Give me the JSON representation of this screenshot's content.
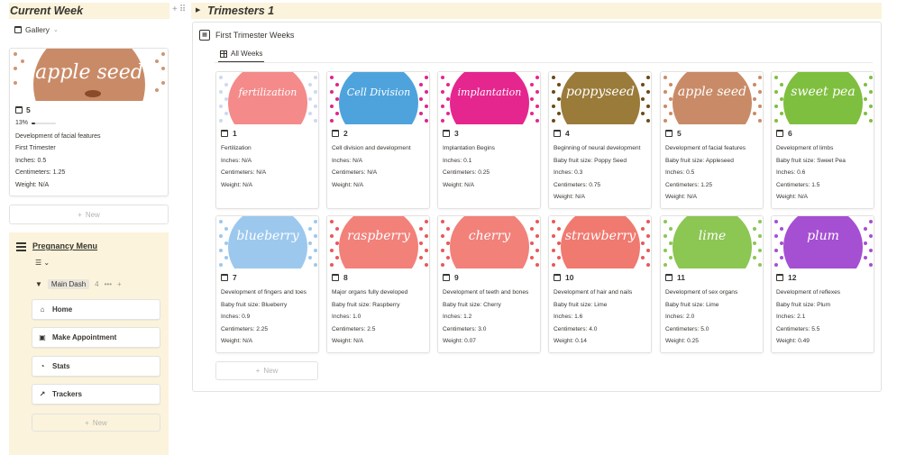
{
  "left": {
    "title": "Current Week",
    "view_label": "Gallery",
    "current": {
      "cover_text": "apple seed",
      "cover_color": "#c98b67",
      "number": "5",
      "progress_label": "13%",
      "progress_value": 0.13,
      "line1": "Development of facial features",
      "line2": "First Trimester",
      "line3": "Inches: 0.5",
      "line4": "Centimeters: 1.25",
      "line5": "Weight: N/A"
    },
    "new_label": "New"
  },
  "menu": {
    "title": "Pregnancy Menu",
    "group_label": "Main Dash",
    "group_count": "4",
    "buttons": [
      "Home",
      "Make Appointment",
      "Stats",
      "Trackers"
    ],
    "new_label": "New"
  },
  "right": {
    "section_title": "Trimesters 1",
    "database_title": "First Trimester Weeks",
    "tab_label": "All Weeks",
    "new_label": "New"
  },
  "weeks": [
    {
      "number": "1",
      "cover_text": "fertilization",
      "bg": "#f48a8a",
      "dot": "#cfd8f0",
      "desc": "Fertilization",
      "fruit": "",
      "inches": "Inches: N/A",
      "cm": "Centimeters: N/A",
      "weight": "Weight: N/A"
    },
    {
      "number": "2",
      "cover_text": "Cell Division",
      "bg": "#4ea3dd",
      "dot": "#e0248c",
      "desc": "Cell division and development",
      "fruit": "",
      "inches": "Inches: N/A",
      "cm": "Centimeters: N/A",
      "weight": "Weight: N/A"
    },
    {
      "number": "3",
      "cover_text": "implantation",
      "bg": "#e5268f",
      "dot": "#e5268f",
      "desc": "Implantation Begins",
      "fruit": "",
      "inches": "Inches: 0.1",
      "cm": "Centimeters: 0.25",
      "weight": "Weight: N/A"
    },
    {
      "number": "4",
      "cover_text": "poppyseed",
      "bg": "#9a7b3a",
      "dot": "#6b4a1a",
      "desc": "Beginning of neural development",
      "fruit": "Baby fruit size: Poppy Seed",
      "inches": "Inches: 0.3",
      "cm": "Centimeters: 0.75",
      "weight": "Weight: N/A"
    },
    {
      "number": "5",
      "cover_text": "apple seed",
      "bg": "#c98b67",
      "dot": "#c98b67",
      "desc": "Development of facial features",
      "fruit": "Baby fruit size: Appleseed",
      "inches": "Inches: 0.5",
      "cm": "Centimeters: 1.25",
      "weight": "Weight: N/A"
    },
    {
      "number": "6",
      "cover_text": "sweet pea",
      "bg": "#7fbf3f",
      "dot": "#7fbf3f",
      "desc": "Development of limbs",
      "fruit": "Baby fruit size: Sweet Pea",
      "inches": "Inches: 0.6",
      "cm": "Centimeters: 1.5",
      "weight": "Weight: N/A"
    },
    {
      "number": "7",
      "cover_text": "blueberry",
      "bg": "#9cc8ee",
      "dot": "#9cc8ee",
      "desc": "Development of fingers and toes",
      "fruit": "Baby fruit size: Blueberry",
      "inches": "Inches: 0.9",
      "cm": "Centimeters: 2.25",
      "weight": "Weight: N/A"
    },
    {
      "number": "8",
      "cover_text": "raspberry",
      "bg": "#f2817a",
      "dot": "#e8585a",
      "desc": "Major organs fully developed",
      "fruit": "Baby fruit size: Raspberry",
      "inches": "Inches: 1.0",
      "cm": "Centimeters: 2.5",
      "weight": "Weight: N/A"
    },
    {
      "number": "9",
      "cover_text": "cherry",
      "bg": "#f2817a",
      "dot": "#e8585a",
      "desc": "Development of teeth and bones",
      "fruit": "Baby fruit size: Cherry",
      "inches": "Inches: 1.2",
      "cm": "Centimeters: 3.0",
      "weight": "Weight: 0.07"
    },
    {
      "number": "10",
      "cover_text": "strawberry",
      "bg": "#f07a70",
      "dot": "#e8585a",
      "desc": "Development of hair and nails",
      "fruit": "Baby fruit size: Lime",
      "inches": "Inches: 1.6",
      "cm": "Centimeters: 4.0",
      "weight": "Weight: 0.14"
    },
    {
      "number": "11",
      "cover_text": "lime",
      "bg": "#8cc653",
      "dot": "#8cc653",
      "desc": "Development of sex organs",
      "fruit": "Baby fruit size: Lime",
      "inches": "Inches: 2.0",
      "cm": "Centimeters: 5.0",
      "weight": "Weight: 0.25"
    },
    {
      "number": "12",
      "cover_text": "plum",
      "bg": "#a54fd3",
      "dot": "#a54fd3",
      "desc": "Development of reflexes",
      "fruit": "Baby fruit size: Plum",
      "inches": "Inches: 2.1",
      "cm": "Centimeters: 5.5",
      "weight": "Weight: 0.49"
    }
  ]
}
